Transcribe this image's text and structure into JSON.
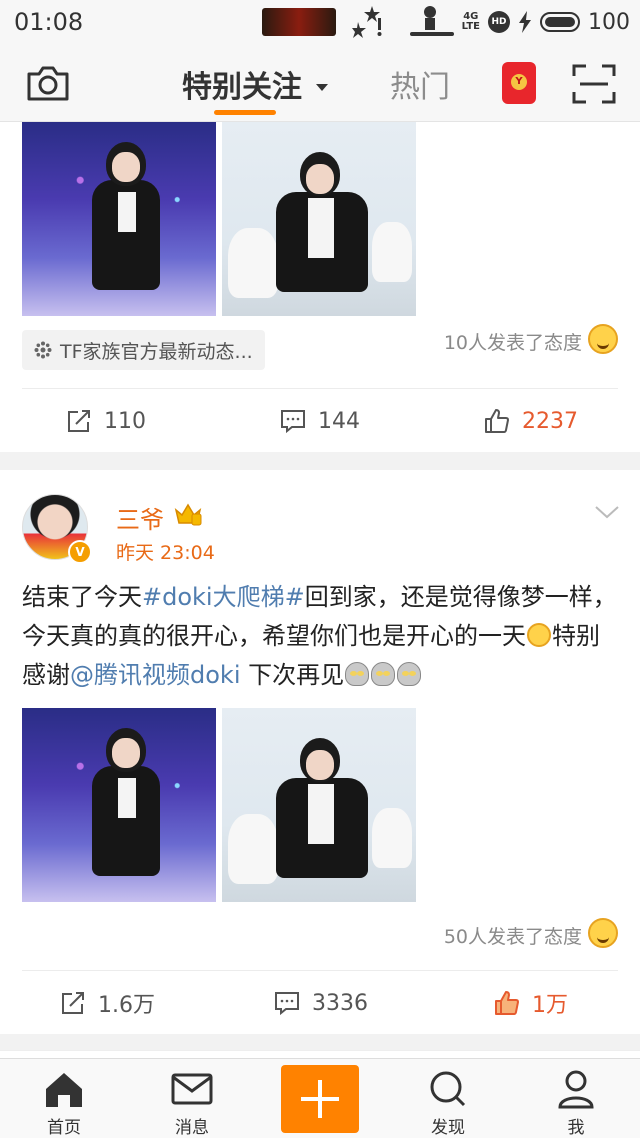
{
  "status": {
    "time": "01:08",
    "network": "4G",
    "network_sub": "LTE",
    "hd": "HD",
    "battery": "100"
  },
  "nav": {
    "tab_follow": "特别关注",
    "tab_hot": "热门"
  },
  "card1": {
    "topic_chip": "TF家族官方最新动态...",
    "attitude": "10人发表了态度",
    "repost_count": "110",
    "comment_count": "144",
    "like_count": "2237"
  },
  "card2": {
    "author": "三爷",
    "verified": "V",
    "time": "昨天 23:04",
    "text": {
      "p1": "结束了今天",
      "topic": "#doki大爬梯#",
      "p2": "回到家，还是觉得像梦一样，今天真的真的很开心，希望你们也是开心的一天",
      "p3": "特别感谢",
      "mention": "@腾讯视频doki",
      "p4": " 下次再见"
    },
    "attitude": "50人发表了态度",
    "repost_count": "1.6万",
    "comment_count": "3336",
    "like_count": "1万"
  },
  "tabs": {
    "home": "首页",
    "messages": "消息",
    "discover": "发现",
    "me": "我"
  },
  "colors": {
    "accent": "#ff8200",
    "link": "#507daf",
    "name": "#e86a17"
  }
}
